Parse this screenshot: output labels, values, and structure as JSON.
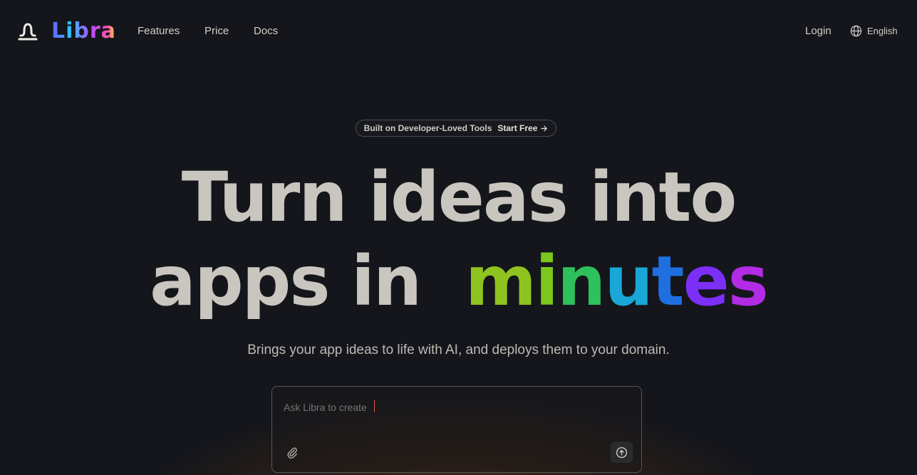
{
  "header": {
    "brand": "Libra",
    "nav": [
      "Features",
      "Price",
      "Docs"
    ],
    "login": "Login",
    "language": "English"
  },
  "badge": {
    "text": "Built on Developer-Loved Tools",
    "cta": "Start Free"
  },
  "hero": {
    "line1": "Turn ideas into",
    "line2_prefix": "apps in",
    "highlight": "minutes",
    "highlight_colors": [
      "#8fc31f",
      "#7cc61d",
      "#2ec05a",
      "#18a7d6",
      "#1f6fe0",
      "#7b2ff7",
      "#b32be4",
      "#e02db3"
    ]
  },
  "subtitle": "Brings your app ideas to life with AI, and deploys them to your domain.",
  "prompt": {
    "placeholder": "Ask Libra to create"
  },
  "icons": {
    "logo": "libra-scale-icon",
    "language": "globe-icon",
    "badge_cta": "arrow-right-icon",
    "attach": "paperclip-icon",
    "send": "arrow-up-circle-icon"
  }
}
